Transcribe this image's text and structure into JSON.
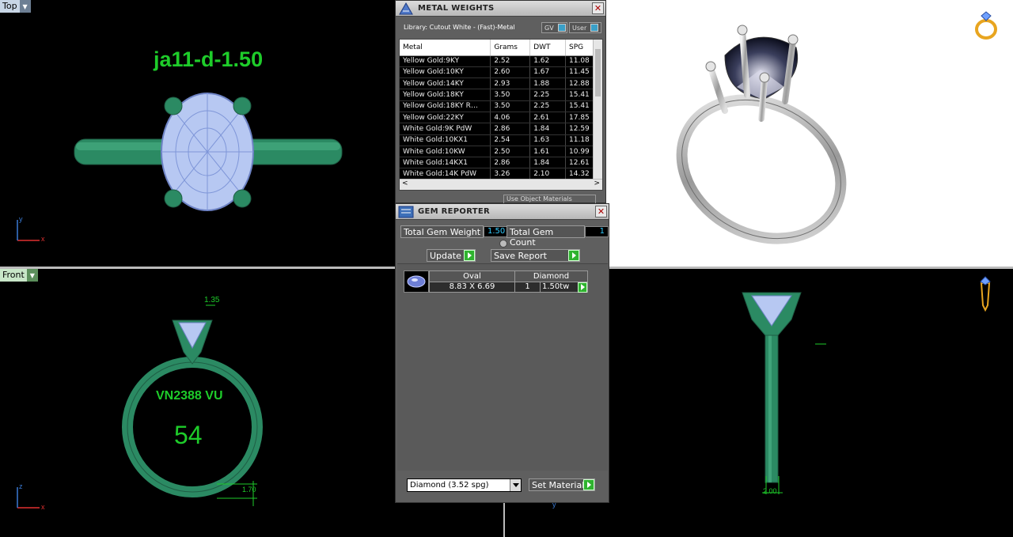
{
  "viewports": {
    "top": {
      "label": "Top",
      "model_name": "ja11-d-1.50",
      "axis_x": "x",
      "axis_y": "y"
    },
    "front": {
      "label": "Front",
      "engraving_top": "VN2388 VU",
      "engraving_size": "54",
      "dim_top": "1.35",
      "dim_bottom": "1.70",
      "axis_x": "x",
      "axis_z": "z"
    },
    "right": {
      "dim_bottom": "2.00",
      "axis_y": "y"
    }
  },
  "metal_weights": {
    "title": "METAL WEIGHTS",
    "library": "Library: Cutout White - (Fast)-Metal",
    "toggle_gv": "GV",
    "toggle_user": "User",
    "columns": [
      "Metal",
      "Grams",
      "DWT",
      "SPG"
    ],
    "rows": [
      [
        "Yellow Gold:9KY",
        "2.52",
        "1.62",
        "11.08"
      ],
      [
        "Yellow Gold:10KY",
        "2.60",
        "1.67",
        "11.45"
      ],
      [
        "Yellow Gold:14KY",
        "2.93",
        "1.88",
        "12.88"
      ],
      [
        "Yellow Gold:18KY",
        "3.50",
        "2.25",
        "15.41"
      ],
      [
        "Yellow Gold:18KY R…",
        "3.50",
        "2.25",
        "15.41"
      ],
      [
        "Yellow Gold:22KY",
        "4.06",
        "2.61",
        "17.85"
      ],
      [
        "White Gold:9K PdW",
        "2.86",
        "1.84",
        "12.59"
      ],
      [
        "White Gold:10KX1",
        "2.54",
        "1.63",
        "11.18"
      ],
      [
        "White Gold:10KW",
        "2.50",
        "1.61",
        "10.99"
      ],
      [
        "White Gold:14KX1",
        "2.86",
        "1.84",
        "12.61"
      ],
      [
        "White Gold:14K PdW",
        "3.26",
        "2.10",
        "14.32"
      ]
    ],
    "use_object_materials": "Use Object Materials"
  },
  "gem_reporter": {
    "title": "GEM REPORTER",
    "total_weight_label": "Total Gem Weight",
    "total_weight_value": "1.50",
    "total_count_label": "Total Gem Count",
    "total_count_value": "1",
    "update_label": "Update",
    "save_report_label": "Save Report",
    "gem": {
      "shape": "Oval",
      "material": "Diamond",
      "size": "8.83 X 6.69",
      "count": "1",
      "weight": "1.50tw"
    },
    "material_select": "Diamond    (3.52 spg)",
    "set_material_label": "Set Material"
  },
  "colors": {
    "model_green": "#2f8f68",
    "text_green": "#1ecc2a",
    "gem_blue": "#b7c8f2"
  }
}
